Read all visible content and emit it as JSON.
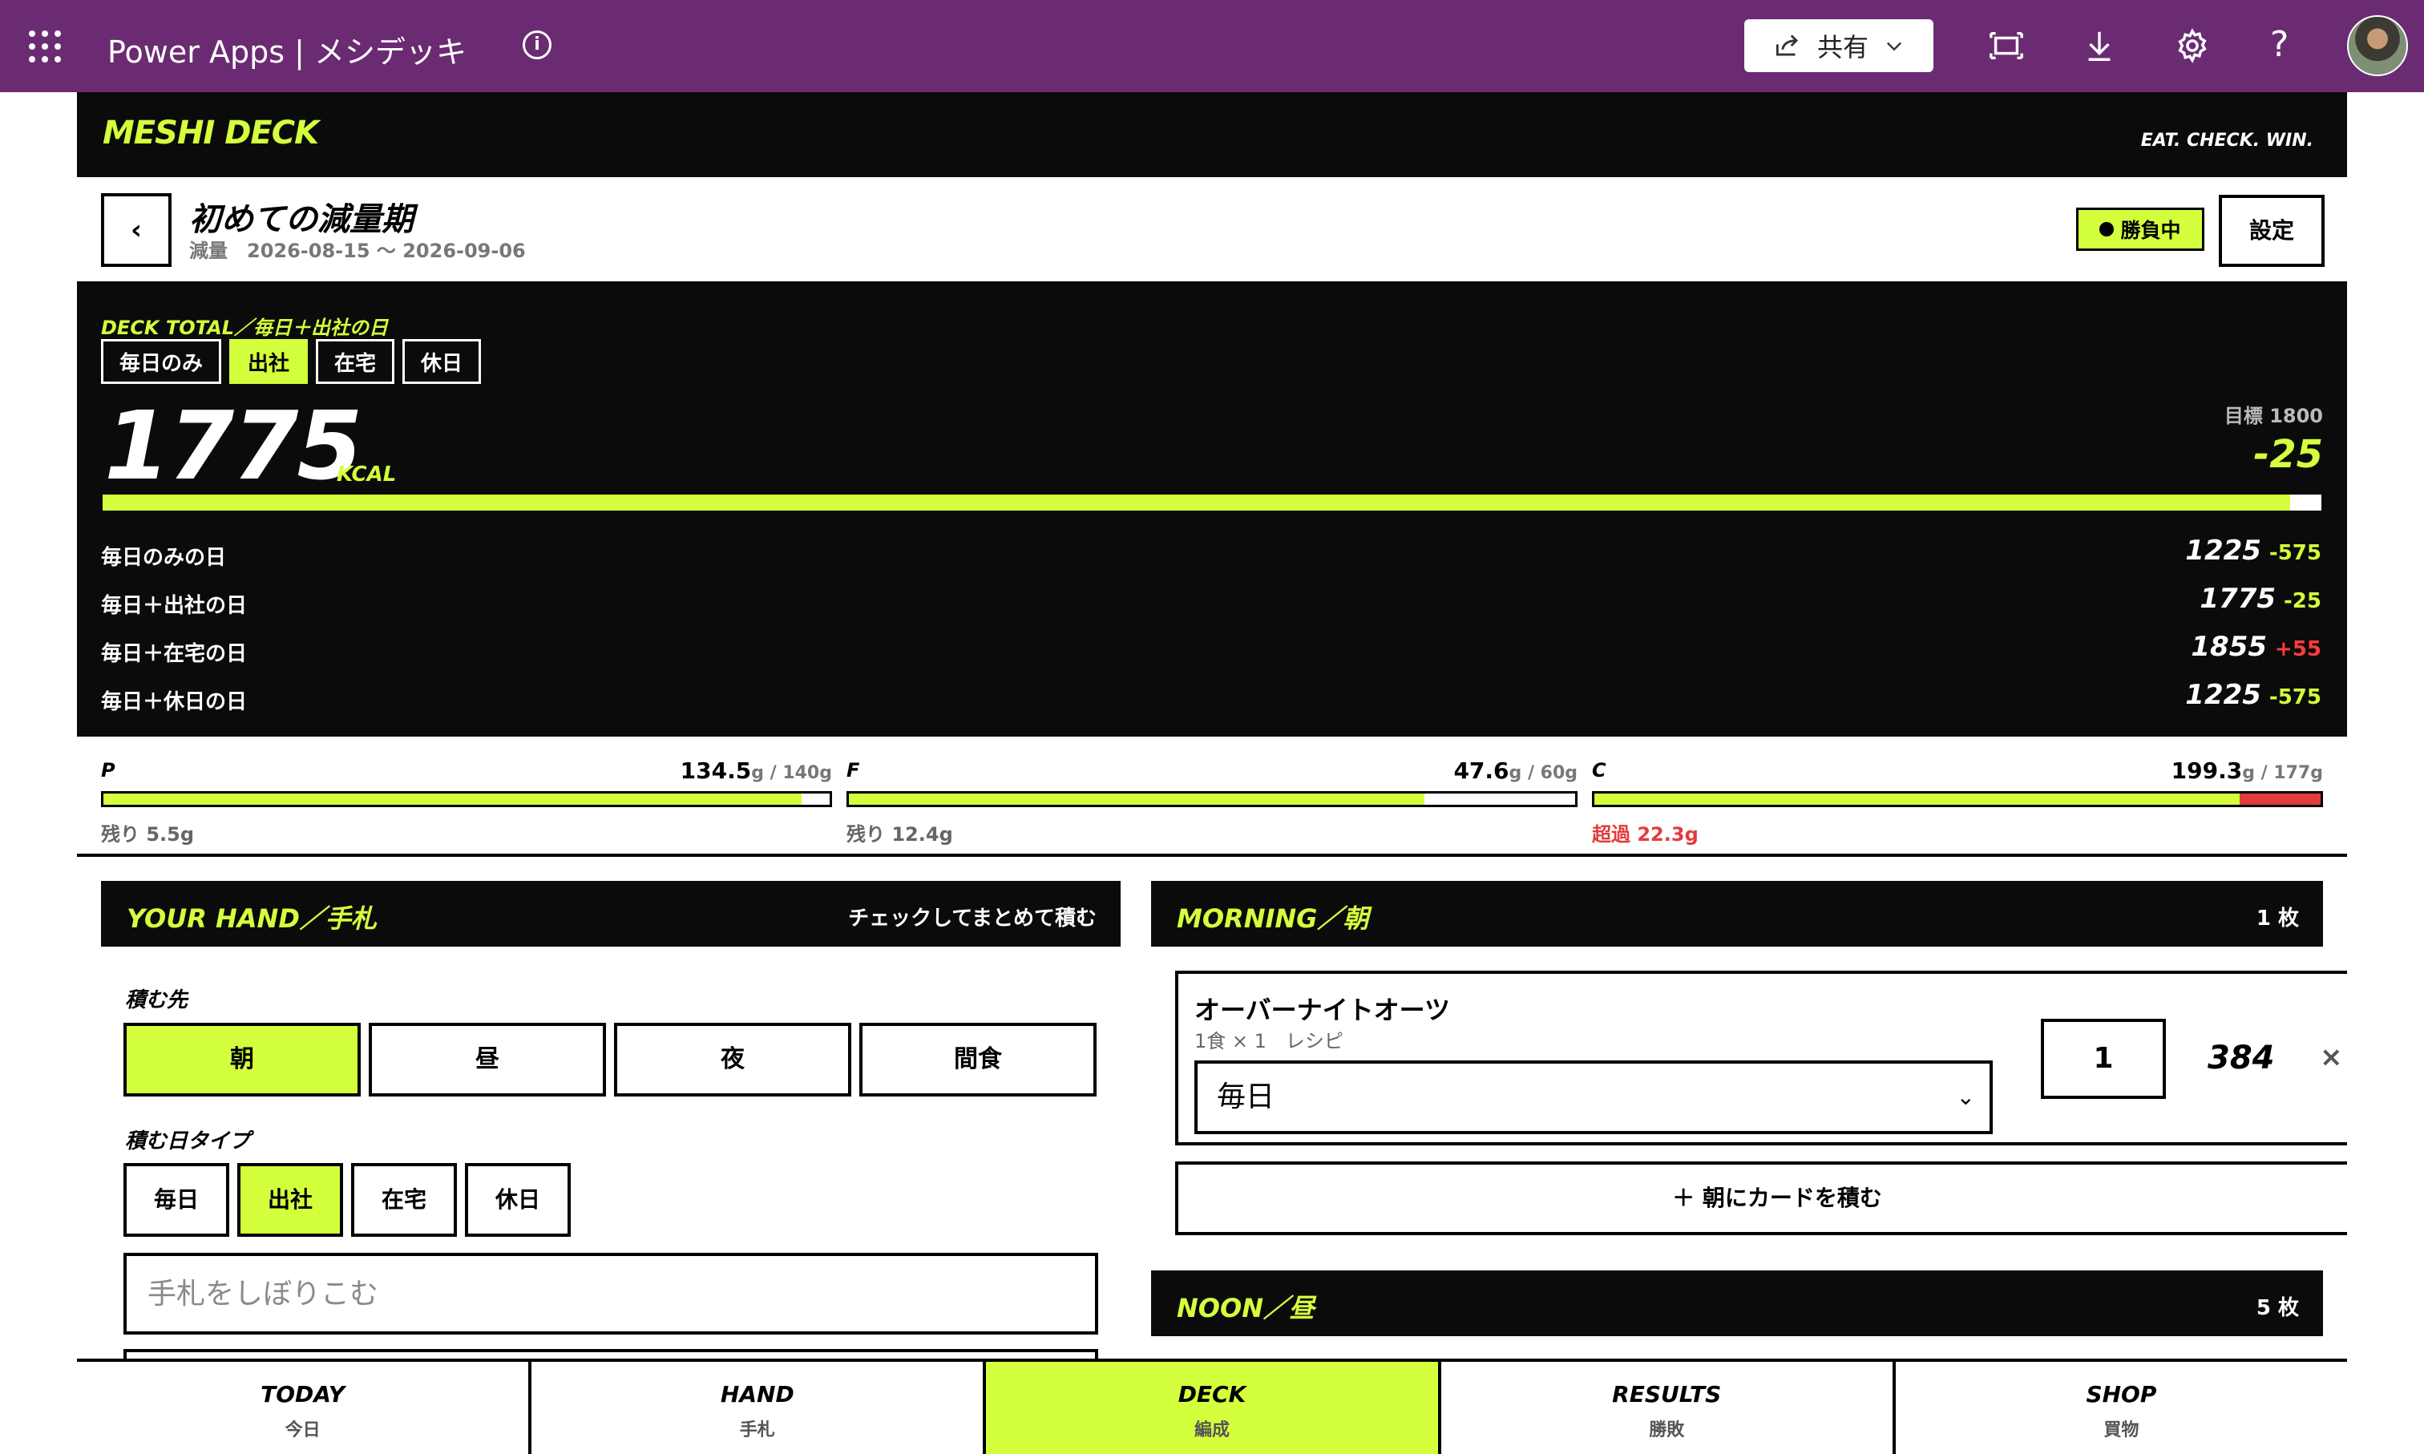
{
  "powerapps": {
    "title": "Power Apps | メシデッキ",
    "share_label": "共有",
    "help_glyph": "?"
  },
  "brand": {
    "logo": "MESHI DECK",
    "tagline": "EAT. CHECK. WIN."
  },
  "plan": {
    "back_glyph": "‹",
    "title": "初めての減量期",
    "phase": "減量",
    "dates": "2026-08-15 〜 2026-09-06",
    "status": "勝負中",
    "settings_label": "設定"
  },
  "deck_total": {
    "label": "DECK TOTAL／毎日＋出社の日",
    "chips": [
      "毎日のみ",
      "出社",
      "在宅",
      "休日"
    ],
    "active_chip": "出社",
    "kcal": "1775",
    "unit": "KCAL",
    "goal_label": "目標 1800",
    "diff": "-25",
    "progress": 0.986,
    "days": [
      {
        "name": "毎日のみの日",
        "kcal": "1225",
        "diff": "-575",
        "over": false
      },
      {
        "name": "毎日＋出社の日",
        "kcal": "1775",
        "diff": "-25",
        "over": false
      },
      {
        "name": "毎日＋在宅の日",
        "kcal": "1855",
        "diff": "+55",
        "over": true
      },
      {
        "name": "毎日＋休日の日",
        "kcal": "1225",
        "diff": "-575",
        "over": false
      }
    ]
  },
  "macros": [
    {
      "key": "P",
      "value": "134.5",
      "target": "g / 140g",
      "fill": 0.961,
      "over": 0,
      "note": "残り 5.5g",
      "is_over": false
    },
    {
      "key": "F",
      "value": "47.6",
      "target": "g / 60g",
      "fill": 0.793,
      "over": 0,
      "note": "残り 12.4g",
      "is_over": false
    },
    {
      "key": "C",
      "value": "199.3",
      "target": "g / 177g",
      "fill": 0.888,
      "over": 0.112,
      "note": "超過 22.3g",
      "is_over": true
    }
  ],
  "hand": {
    "title": "YOUR HAND／手札",
    "subtitle": "チェックしてまとめて積む",
    "target_label": "積む先",
    "slots": [
      "朝",
      "昼",
      "夜",
      "間食"
    ],
    "active_slot": "朝",
    "daytype_label": "積む日タイプ",
    "day_types": [
      "毎日",
      "出社",
      "在宅",
      "休日"
    ],
    "active_daytype": "出社",
    "filter_placeholder": "手札をしぼりこむ"
  },
  "morning": {
    "title": "MORNING／朝",
    "count": "1 枚",
    "card": {
      "name": "オーバーナイトオーツ",
      "meta": "1食 × 1　レシピ",
      "daytype": "毎日",
      "qty": "1",
      "kcal": "384",
      "remove_glyph": "×"
    },
    "add_label": "＋ 朝にカードを積む"
  },
  "noon": {
    "title": "NOON／昼",
    "count": "5 枚"
  },
  "nav": [
    {
      "en": "TODAY",
      "ja": "今日",
      "active": false
    },
    {
      "en": "HAND",
      "ja": "手札",
      "active": false
    },
    {
      "en": "DECK",
      "ja": "編成",
      "active": true
    },
    {
      "en": "RESULTS",
      "ja": "勝敗",
      "active": false
    },
    {
      "en": "SHOP",
      "ja": "買物",
      "active": false
    }
  ],
  "colors": {
    "accent": "#d4ff3c",
    "header": "#6b2b72",
    "panel": "#0b0b0b",
    "over": "#e23b3b"
  }
}
